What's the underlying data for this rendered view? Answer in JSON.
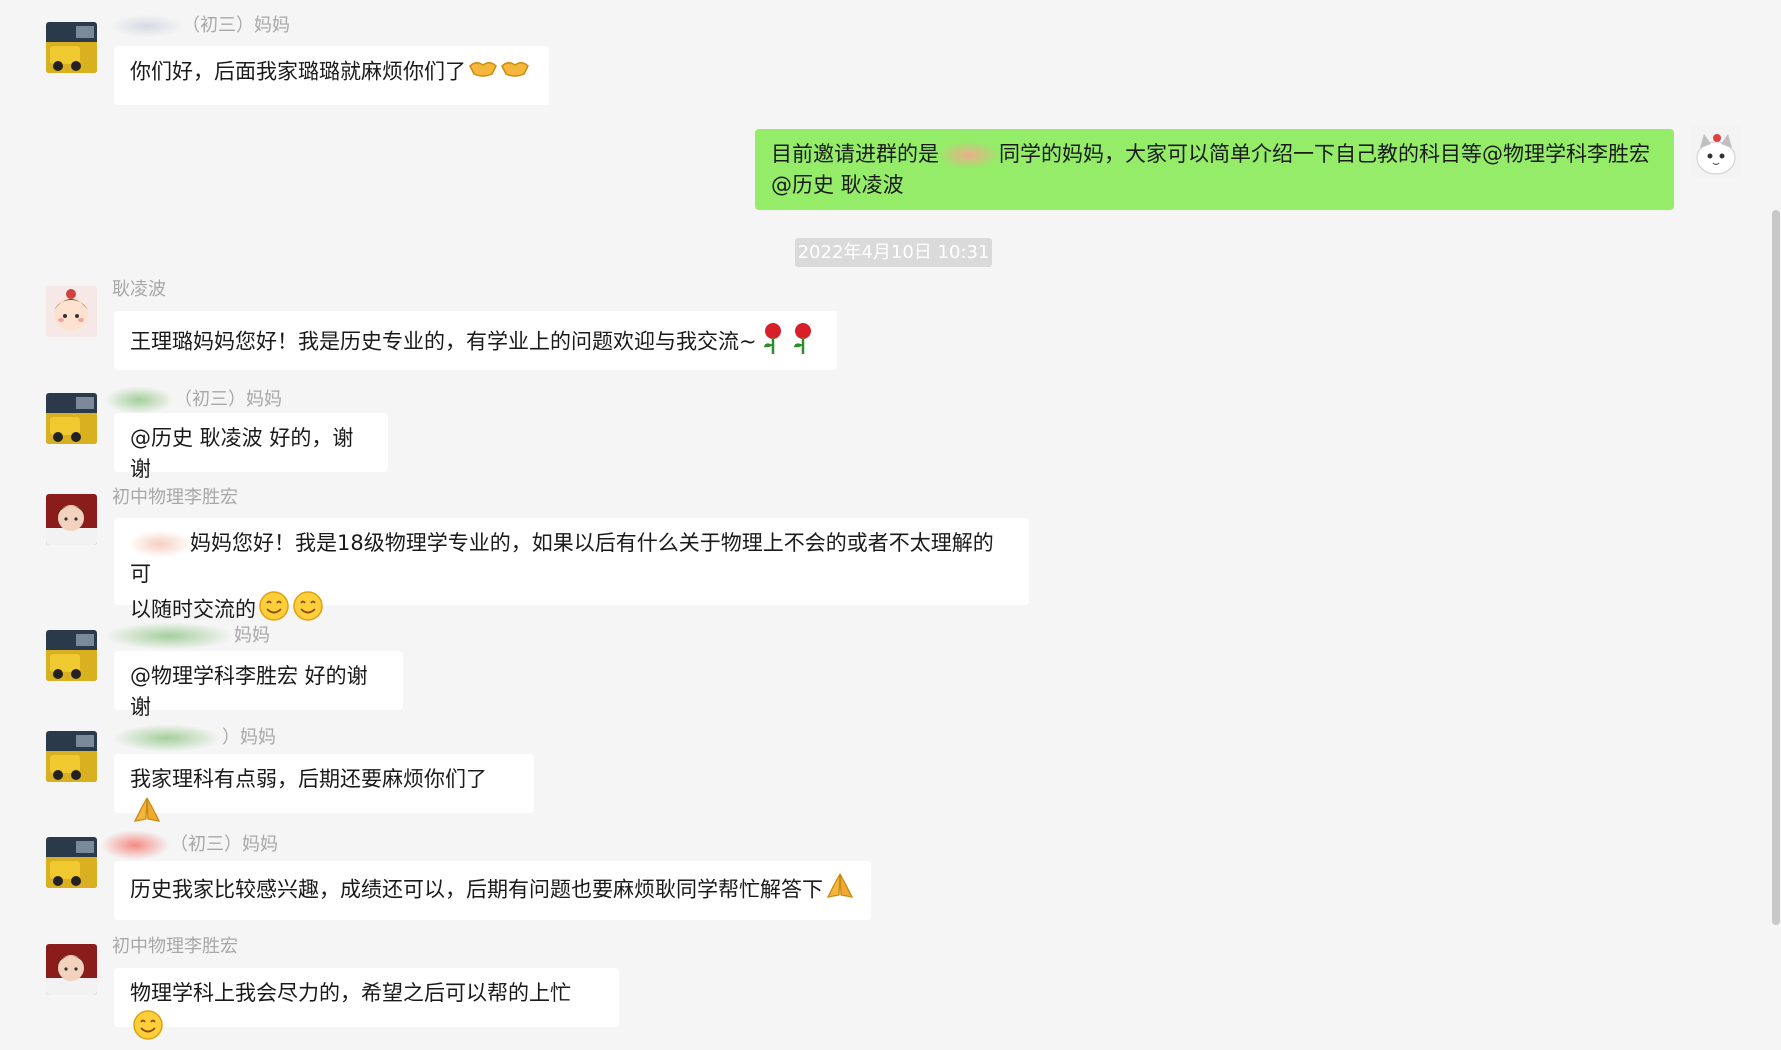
{
  "timestamp": "2022年4月10日 10:31",
  "messages": [
    {
      "sender_suffix": "（初三）妈妈",
      "text": "你们好，后面我家璐璐就麻烦你们了",
      "emoji": [
        "handshake-emoji",
        "handshake-emoji"
      ]
    },
    {
      "mine": true,
      "text_before": "目前邀请进群的是",
      "text_after": "同学的妈妈，大家可以简单介绍一下自己教的科目等@物理学科李胜宏",
      "text_line2": "@历史 耿凌波"
    },
    {
      "sender": "耿凌波",
      "text": "王理璐妈妈您好！我是历史专业的，有学业上的问题欢迎与我交流~",
      "emoji": [
        "rose-emoji",
        "rose-emoji"
      ]
    },
    {
      "sender_suffix": "（初三）妈妈",
      "text": "@历史 耿凌波 好的，谢谢"
    },
    {
      "sender": "初中物理李胜宏",
      "text_line1": "妈妈您好！我是18级物理学专业的，如果以后有什么关于物理上不会的或者不太理解的可",
      "text_line2": "以随时交流的",
      "emoji": [
        "smile-emoji",
        "smile-emoji"
      ]
    },
    {
      "sender_suffix": "妈妈",
      "text": "@物理学科李胜宏 好的谢谢"
    },
    {
      "sender_suffix": "）妈妈",
      "text": "我家理科有点弱，后期还要麻烦你们了",
      "emoji": [
        "pray-emoji"
      ]
    },
    {
      "sender_suffix": "（初三）妈妈",
      "text": "历史我家比较感兴趣，成绩还可以，后期有问题也要麻烦耿同学帮忙解答下",
      "emoji": [
        "pray-emoji"
      ]
    },
    {
      "sender": "初中物理李胜宏",
      "text": "物理学科上我会尽力的，希望之后可以帮的上忙",
      "emoji": [
        "smile-emoji"
      ]
    }
  ],
  "colors": {
    "background": "#f5f5f5",
    "bubble_mine": "#95ec69",
    "bubble_other": "#ffffff",
    "sender_name": "#a8a8a8",
    "timestamp_bg": "#dadada"
  }
}
